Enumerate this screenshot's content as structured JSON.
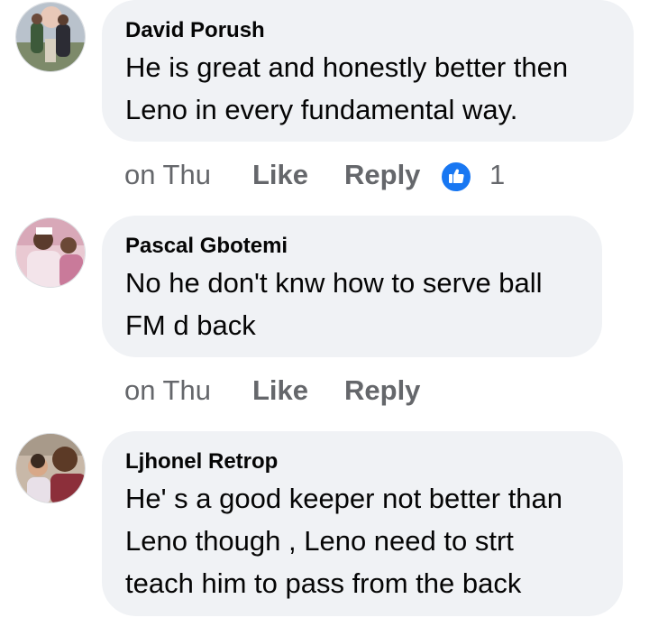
{
  "comments": [
    {
      "author": "David Porush",
      "lines": [
        "He is great and honestly better then",
        "Leno in every fundamental way."
      ],
      "time": "on Thu",
      "like_label": "Like",
      "reply_label": "Reply",
      "reaction_icon": "like-icon",
      "reaction_count": "1"
    },
    {
      "author": "Pascal Gbotemi",
      "lines": [
        "No he don't knw how to serve ball",
        "FM d back"
      ],
      "time": "on Thu",
      "like_label": "Like",
      "reply_label": "Reply"
    },
    {
      "author": "Ljhonel Retrop",
      "lines": [
        "He' s a good keeper not better than",
        "Leno though , Leno need to strt",
        "teach him to pass from the back"
      ],
      "time": "",
      "like_label": "",
      "reply_label": ""
    }
  ],
  "colors": {
    "bubble": "#f0f2f5",
    "action_text": "#65676b",
    "like_blue": "#1877f2"
  }
}
